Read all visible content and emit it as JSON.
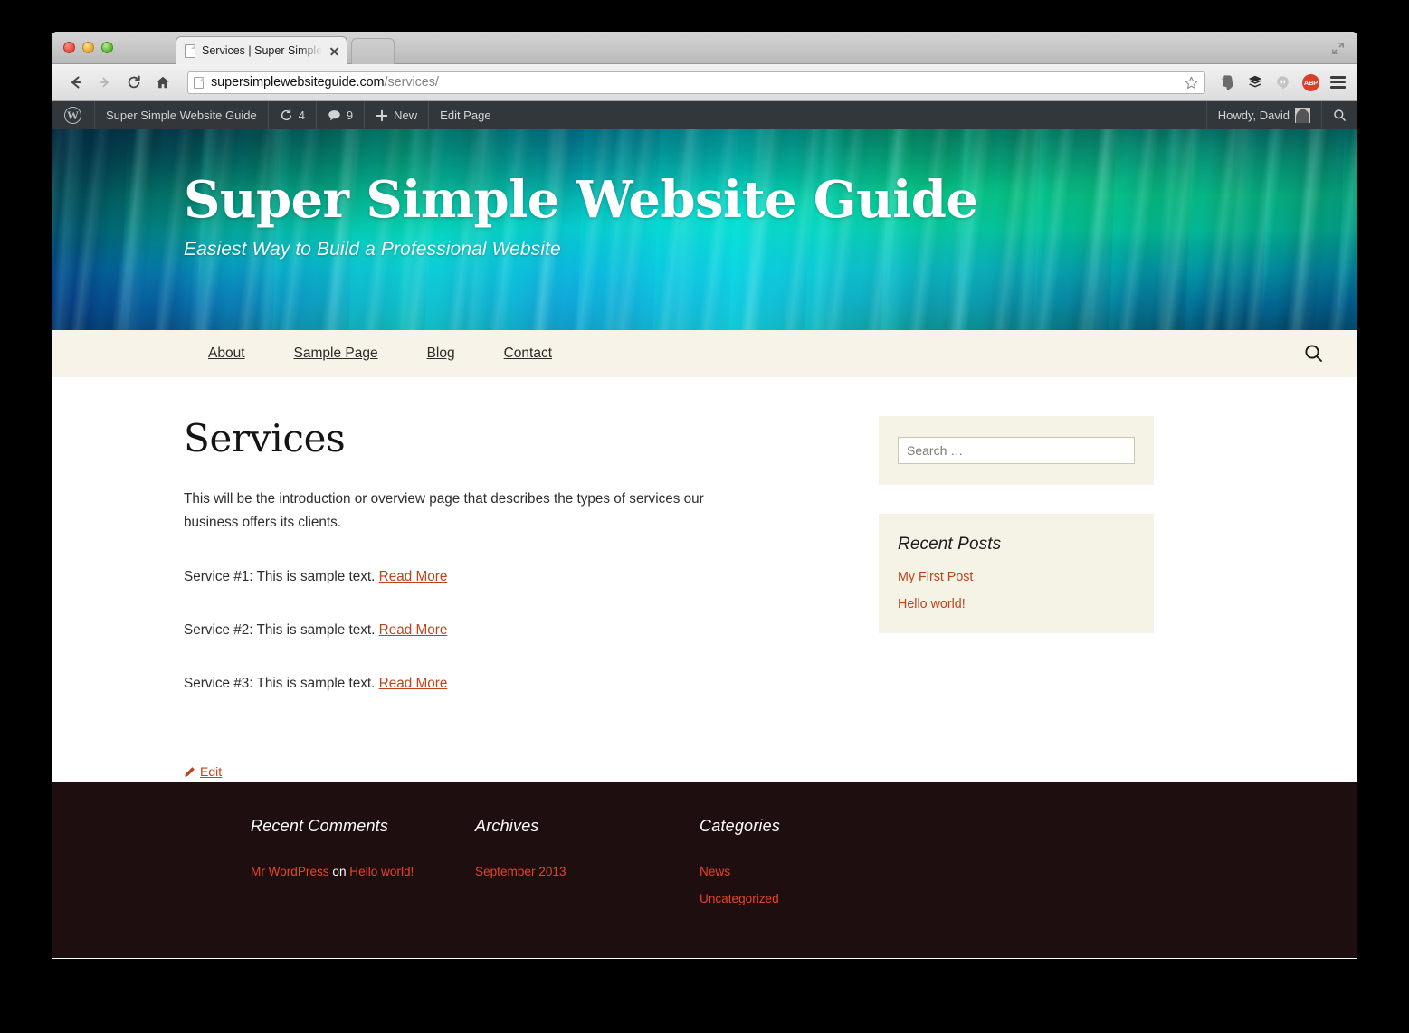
{
  "browser": {
    "tab_title": "Services | Super Simple We",
    "url_domain": "supersimplewebsiteguide.com",
    "url_path": "/services/",
    "back_icon": "back-arrow-icon",
    "forward_icon": "forward-arrow-icon",
    "reload_icon": "reload-icon",
    "home_icon": "home-icon",
    "bookmark_icon": "star-icon",
    "extensions": [
      "evernote-icon",
      "buffer-icon",
      "hangouts-icon",
      "adblock-plus-icon",
      "menu-icon"
    ],
    "abp_label": "ABP"
  },
  "adminbar": {
    "wp_logo": "W",
    "site_name": "Super Simple Website Guide",
    "updates_count": "4",
    "comments_count": "9",
    "new_label": "New",
    "edit_page_label": "Edit Page",
    "howdy": "Howdy, David",
    "search_icon": "search-icon"
  },
  "banner": {
    "title": "Super Simple Website Guide",
    "tagline": "Easiest Way to Build a Professional Website"
  },
  "nav": {
    "items": [
      {
        "label": "About"
      },
      {
        "label": "Sample Page"
      },
      {
        "label": "Blog"
      },
      {
        "label": "Contact"
      }
    ],
    "search_icon": "search-icon"
  },
  "content": {
    "title": "Services",
    "intro": "This will be the introduction or overview page that describes the types of services our business offers its clients.",
    "services": [
      {
        "text": "Service #1: This is sample text. ",
        "link": "Read More"
      },
      {
        "text": "Service #2: This is sample text. ",
        "link": "Read More"
      },
      {
        "text": "Service #3: This is sample text. ",
        "link": "Read More"
      }
    ],
    "edit_label": "Edit",
    "edit_icon": "pencil-icon"
  },
  "sidebar": {
    "search_placeholder": "Search …",
    "recent_posts": {
      "title": "Recent Posts",
      "items": [
        {
          "label": "My First Post"
        },
        {
          "label": "Hello world!"
        }
      ]
    }
  },
  "footer": {
    "recent_comments": {
      "title": "Recent Comments",
      "author": "Mr WordPress",
      "on": " on ",
      "post": "Hello world!"
    },
    "archives": {
      "title": "Archives",
      "items": [
        {
          "label": "September 2013"
        }
      ]
    },
    "categories": {
      "title": "Categories",
      "items": [
        {
          "label": "News"
        },
        {
          "label": "Uncategorized"
        }
      ]
    }
  },
  "colors": {
    "accent_link": "#c0431c",
    "footer_bg": "#1f0e0f",
    "widget_bg": "#f5f2e6",
    "nav_bg": "#f7f3e8",
    "adminbar_bg": "#32373c"
  }
}
